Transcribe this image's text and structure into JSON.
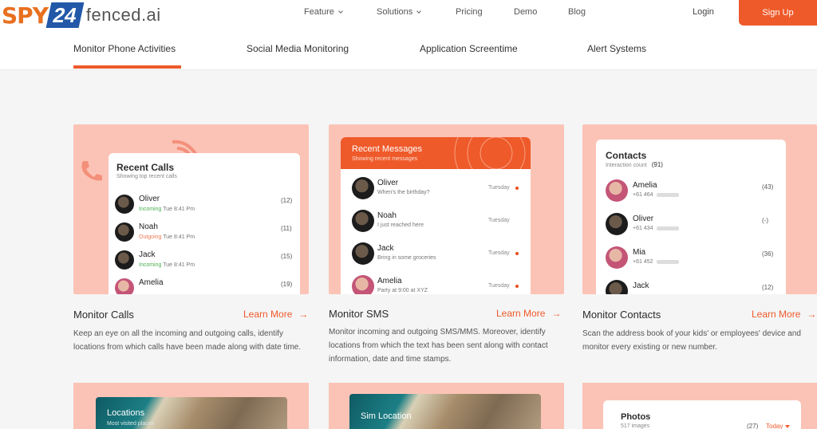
{
  "brand": {
    "spy": "SPY",
    "num": "24",
    "fenced": "fenced.ai"
  },
  "nav": {
    "feature": "Feature",
    "solutions": "Solutions",
    "pricing": "Pricing",
    "demo": "Demo",
    "blog": "Blog",
    "login": "Login",
    "signup": "Sign Up"
  },
  "tabs": [
    "Monitor Phone Activities",
    "Social Media Monitoring",
    "Application Screentime",
    "Alert Systems"
  ],
  "calls_card": {
    "title": "Recent Calls",
    "subtitle": "Showing top recent calls",
    "rows": [
      {
        "name": "Oliver",
        "direction": "Incoming",
        "time": "Tue 8:41 Pm",
        "count": "(12)"
      },
      {
        "name": "Noah",
        "direction": "Outgoing",
        "time": "Tue 8:41 Pm",
        "count": "(11)"
      },
      {
        "name": "Jack",
        "direction": "Incoming",
        "time": "Tue 8:41 Pm",
        "count": "(15)"
      },
      {
        "name": "Amelia",
        "direction": "",
        "time": "",
        "count": "(19)"
      }
    ]
  },
  "sms_card": {
    "title": "Recent Messages",
    "subtitle": "Showing recent messages",
    "rows": [
      {
        "name": "Oliver",
        "text": "When's the birthday?",
        "day": "Tuesday"
      },
      {
        "name": "Noah",
        "text": "I just reached here",
        "day": "Tuesday"
      },
      {
        "name": "Jack",
        "text": "Bring in some groceries",
        "day": "Tuesday"
      },
      {
        "name": "Amelia",
        "text": "Party at 9:00 at XYZ",
        "day": "Tuesday"
      }
    ]
  },
  "contacts_card": {
    "title": "Contacts",
    "subtitle": "Interaction count",
    "total": "(91)",
    "rows": [
      {
        "name": "Amelia",
        "phone": "+61 464",
        "count": "(43)"
      },
      {
        "name": "Oliver",
        "phone": "+61 434",
        "count": "(-)"
      },
      {
        "name": "Mia",
        "phone": "+61 452",
        "count": "(36)"
      },
      {
        "name": "Jack",
        "phone": "",
        "count": "(12)"
      }
    ]
  },
  "features": [
    {
      "title": "Monitor Calls",
      "learn": "Learn More",
      "desc": "Keep an eye on all the incoming and outgoing calls, identify locations from which calls have been made along with date time."
    },
    {
      "title": "Monitor SMS",
      "learn": "Learn More",
      "desc": "Monitor incoming and outgoing SMS/MMS. Moreover, identify locations from which the text has been sent along with contact information, date and time stamps."
    },
    {
      "title": "Monitor Contacts",
      "learn": "Learn More",
      "desc": "Scan the address book of your kids' or employees' device and monitor every existing or new number."
    }
  ],
  "bottom_cards": {
    "locations": {
      "title": "Locations",
      "subtitle": "Most visited places"
    },
    "sim": {
      "title": "Sim Location"
    },
    "photos": {
      "title": "Photos",
      "subtitle": "517 images",
      "count": "(27)",
      "filter": "Today"
    }
  },
  "colors": {
    "accent": "#ef5a2a",
    "card_bg": "#fbc3b6",
    "brand_blue": "#2358a8"
  },
  "icons": {
    "arrow": "→",
    "caret": "chevron-down-icon"
  }
}
